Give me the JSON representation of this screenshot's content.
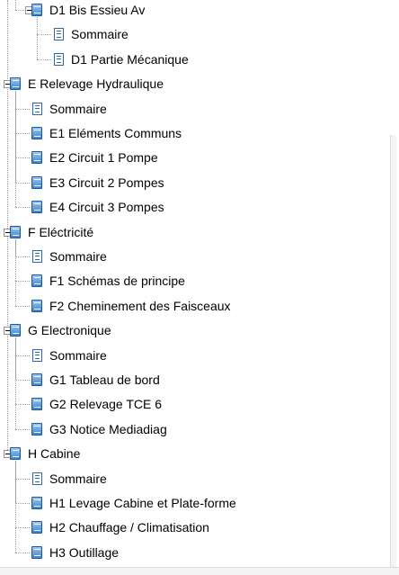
{
  "tree": {
    "items": [
      {
        "label": "D1 Bis Essieu Av",
        "level": 1,
        "kind": "folder",
        "expanded": true
      },
      {
        "label": "Sommaire",
        "level": 2,
        "kind": "doc"
      },
      {
        "label": "D1 Partie Mécanique",
        "level": 2,
        "kind": "doc"
      },
      {
        "label": "E Relevage Hydraulique",
        "level": 0,
        "kind": "folder",
        "expanded": true
      },
      {
        "label": "Sommaire",
        "level": 1,
        "kind": "doc"
      },
      {
        "label": "E1 Eléments Communs",
        "level": 1,
        "kind": "book"
      },
      {
        "label": "E2 Circuit 1 Pompe",
        "level": 1,
        "kind": "book"
      },
      {
        "label": "E3 Circuit 2 Pompes",
        "level": 1,
        "kind": "book"
      },
      {
        "label": "E4 Circuit 3 Pompes",
        "level": 1,
        "kind": "book"
      },
      {
        "label": "F Eléctricité",
        "level": 0,
        "kind": "folder",
        "expanded": true
      },
      {
        "label": "Sommaire",
        "level": 1,
        "kind": "doc"
      },
      {
        "label": "F1 Schémas de principe",
        "level": 1,
        "kind": "book"
      },
      {
        "label": "F2 Cheminement des Faisceaux",
        "level": 1,
        "kind": "book"
      },
      {
        "label": "G Electronique",
        "level": 0,
        "kind": "folder",
        "expanded": true
      },
      {
        "label": "Sommaire",
        "level": 1,
        "kind": "doc"
      },
      {
        "label": "G1 Tableau de bord",
        "level": 1,
        "kind": "book"
      },
      {
        "label": "G2 Relevage TCE 6",
        "level": 1,
        "kind": "book"
      },
      {
        "label": "G3 Notice Mediadiag",
        "level": 1,
        "kind": "book"
      },
      {
        "label": "H Cabine",
        "level": 0,
        "kind": "folder",
        "expanded": true
      },
      {
        "label": "Sommaire",
        "level": 1,
        "kind": "doc"
      },
      {
        "label": "H1 Levage Cabine et Plate-forme",
        "level": 1,
        "kind": "book"
      },
      {
        "label": "H2 Chauffage / Climatisation",
        "level": 1,
        "kind": "book"
      },
      {
        "label": "H3 Outillage",
        "level": 1,
        "kind": "book"
      }
    ]
  },
  "icons": {
    "folder": "book-icon",
    "book": "book-icon",
    "doc": "document-icon",
    "expander": "collapse-toggle-icon"
  },
  "colors": {
    "background": "#ffffff",
    "connector": "#a0a0a0",
    "icon_blue": "#3a86d0"
  }
}
